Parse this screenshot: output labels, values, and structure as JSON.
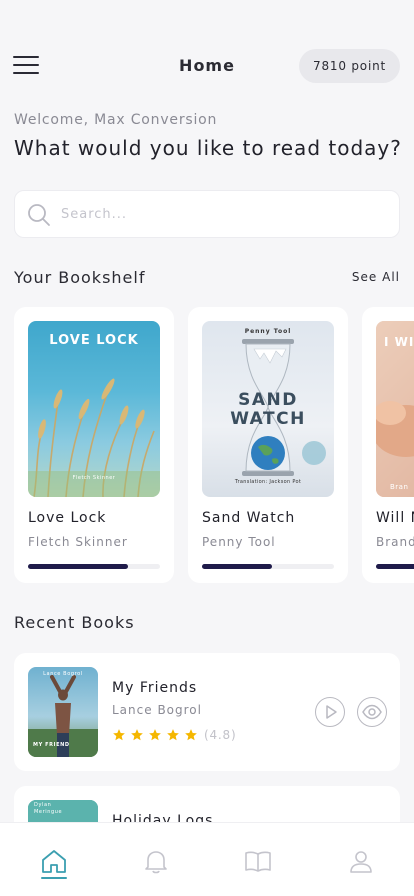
{
  "header": {
    "title": "Home",
    "points": "7810 point"
  },
  "greeting": {
    "welcome": "Welcome, Max Conversion",
    "question": "What would you like to read today?"
  },
  "search": {
    "placeholder": "Search..."
  },
  "bookshelf": {
    "title": "Your Bookshelf",
    "see_all": "See All",
    "books": [
      {
        "title": "Love Lock",
        "author": "Fletch Skinner",
        "cover_title": "LOVE LOCK",
        "cover_author": "Fletch Skinner",
        "progress": 0.76
      },
      {
        "title": "Sand Watch",
        "author": "Penny Tool",
        "cover_header": "Penny Tool",
        "cover_title_1": "SAND",
        "cover_title_2": "WATCH",
        "cover_footer": "Translation: Jackson Pot",
        "progress": 0.53
      },
      {
        "title": "Will N",
        "author": "Brand",
        "cover_title": "I WI",
        "cover_author": "Bran",
        "progress": 0.5
      }
    ]
  },
  "recent": {
    "title": "Recent Books",
    "books": [
      {
        "title": "My Friends",
        "author": "Lance Bogrol",
        "cover_author": "Lance Bogrol",
        "cover_title": "MY FRIEND",
        "rating": "(4.8)",
        "stars": 5
      },
      {
        "title": "Holiday Logs",
        "cover_author": "Dylan Meringue"
      }
    ]
  },
  "colors": {
    "accent": "#3b9fb0",
    "progress": "#1f1b4a",
    "star": "#f5b700"
  },
  "nav": [
    "home-icon",
    "bell-icon",
    "book-icon",
    "user-icon"
  ]
}
